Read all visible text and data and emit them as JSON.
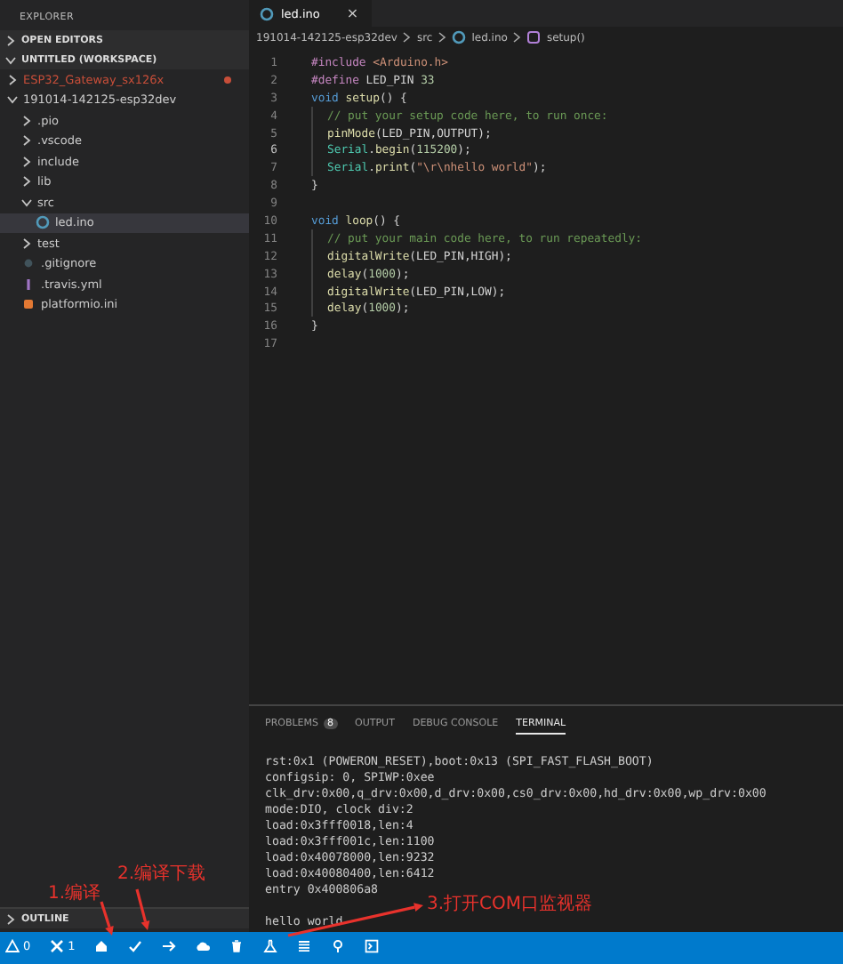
{
  "sidebar": {
    "title": "EXPLORER",
    "sections": [
      {
        "label": "OPEN EDITORS",
        "expanded": false
      },
      {
        "label": "UNTITLED (WORKSPACE)",
        "expanded": true,
        "children": [
          {
            "kind": "folder",
            "label": "ESP32_Gateway_sx126x",
            "expanded": false,
            "modified": true,
            "selected": false
          },
          {
            "kind": "folder",
            "label": "191014-142125-esp32dev",
            "expanded": true,
            "modified": false,
            "selected": false,
            "children": [
              {
                "kind": "folder",
                "label": ".pio",
                "expanded": false,
                "modified": false,
                "selected": false
              },
              {
                "kind": "folder",
                "label": ".vscode",
                "expanded": false,
                "modified": false,
                "selected": false
              },
              {
                "kind": "folder",
                "label": "include",
                "expanded": false,
                "modified": false,
                "selected": false
              },
              {
                "kind": "folder",
                "label": "lib",
                "expanded": false,
                "modified": false,
                "selected": false
              },
              {
                "kind": "folder",
                "label": "src",
                "expanded": true,
                "modified": false,
                "selected": false,
                "children": [
                  {
                    "kind": "c-file",
                    "label": "led.ino",
                    "modified": false,
                    "selected": true
                  }
                ]
              },
              {
                "kind": "folder",
                "label": "test",
                "expanded": false,
                "modified": false,
                "selected": false
              },
              {
                "kind": "git-file",
                "label": ".gitignore",
                "modified": false,
                "selected": false
              },
              {
                "kind": "yaml-file",
                "label": ".travis.yml",
                "modified": false,
                "selected": false
              },
              {
                "kind": "ini-file",
                "label": "platformio.ini",
                "modified": false,
                "selected": false
              }
            ]
          }
        ]
      }
    ],
    "outline": {
      "label": "OUTLINE",
      "expanded": false
    }
  },
  "editor": {
    "tabs": [
      {
        "label": "led.ino",
        "selected": true,
        "close": "×"
      }
    ],
    "breadcrumb": [
      "191014-142125-esp32dev",
      "src",
      "led.ino",
      "setup()"
    ],
    "lines": [
      {
        "number": "1",
        "current": false,
        "indented": false,
        "tokens": [
          {
            "kind": "pre",
            "text": "#include "
          },
          {
            "kind": "str",
            "text": "<Arduino.h>"
          }
        ]
      },
      {
        "number": "2",
        "current": false,
        "indented": false,
        "tokens": [
          {
            "kind": "pre",
            "text": "#define "
          },
          {
            "kind": "plain",
            "text": "LED_PIN "
          },
          {
            "kind": "num",
            "text": "33"
          }
        ]
      },
      {
        "number": "3",
        "current": false,
        "indented": false,
        "tokens": [
          {
            "kind": "key",
            "text": "void "
          },
          {
            "kind": "fn",
            "text": "setup"
          },
          {
            "kind": "plain",
            "text": "() {"
          }
        ]
      },
      {
        "number": "4",
        "current": false,
        "indented": true,
        "tokens": [
          {
            "kind": "comment",
            "text": "// put your setup code here, to run once:"
          }
        ]
      },
      {
        "number": "5",
        "current": false,
        "indented": true,
        "tokens": [
          {
            "kind": "fn",
            "text": "pinMode"
          },
          {
            "kind": "plain",
            "text": "(LED_PIN,OUTPUT);"
          }
        ]
      },
      {
        "number": "6",
        "current": true,
        "indented": true,
        "tokens": [
          {
            "kind": "type",
            "text": "Serial"
          },
          {
            "kind": "plain",
            "text": "."
          },
          {
            "kind": "fn",
            "text": "begin"
          },
          {
            "kind": "plain",
            "text": "("
          },
          {
            "kind": "num",
            "text": "115200"
          },
          {
            "kind": "plain",
            "text": ");"
          }
        ]
      },
      {
        "number": "7",
        "current": false,
        "indented": true,
        "tokens": [
          {
            "kind": "type",
            "text": "Serial"
          },
          {
            "kind": "plain",
            "text": "."
          },
          {
            "kind": "fn",
            "text": "print"
          },
          {
            "kind": "plain",
            "text": "("
          },
          {
            "kind": "str",
            "text": "\"\\r\\nhello world\""
          },
          {
            "kind": "plain",
            "text": ");"
          }
        ]
      },
      {
        "number": "8",
        "current": false,
        "indented": false,
        "tokens": [
          {
            "kind": "plain",
            "text": "}"
          }
        ]
      },
      {
        "number": "9",
        "current": false
      },
      {
        "number": "10",
        "current": false,
        "indented": false,
        "tokens": [
          {
            "kind": "key",
            "text": "void "
          },
          {
            "kind": "fn",
            "text": "loop"
          },
          {
            "kind": "plain",
            "text": "() {"
          }
        ]
      },
      {
        "number": "11",
        "current": false,
        "indented": true,
        "tokens": [
          {
            "kind": "comment",
            "text": "// put your main code here, to run repeatedly:"
          }
        ]
      },
      {
        "number": "12",
        "current": false,
        "indented": true,
        "tokens": [
          {
            "kind": "fn",
            "text": "digitalWrite"
          },
          {
            "kind": "plain",
            "text": "(LED_PIN,HIGH);"
          }
        ]
      },
      {
        "number": "13",
        "current": false,
        "indented": true,
        "tokens": [
          {
            "kind": "fn",
            "text": "delay"
          },
          {
            "kind": "plain",
            "text": "("
          },
          {
            "kind": "num",
            "text": "1000"
          },
          {
            "kind": "plain",
            "text": ");"
          }
        ]
      },
      {
        "number": "14",
        "current": false,
        "indented": true,
        "tokens": [
          {
            "kind": "fn",
            "text": "digitalWrite"
          },
          {
            "kind": "plain",
            "text": "(LED_PIN,LOW);"
          }
        ]
      },
      {
        "number": "15",
        "current": false,
        "indented": true,
        "tokens": [
          {
            "kind": "fn",
            "text": "delay"
          },
          {
            "kind": "plain",
            "text": "("
          },
          {
            "kind": "num",
            "text": "1000"
          },
          {
            "kind": "plain",
            "text": ");"
          }
        ]
      },
      {
        "number": "16",
        "current": false,
        "indented": false,
        "tokens": [
          {
            "kind": "plain",
            "text": "}"
          }
        ]
      },
      {
        "number": "17",
        "current": false
      }
    ]
  },
  "panel": {
    "tabs": [
      {
        "label": "PROBLEMS",
        "badge": "8",
        "selected": false
      },
      {
        "label": "OUTPUT",
        "selected": false
      },
      {
        "label": "DEBUG CONSOLE",
        "selected": false
      },
      {
        "label": "TERMINAL",
        "selected": true
      }
    ],
    "terminal": [
      "rst:0x1 (POWERON_RESET),boot:0x13 (SPI_FAST_FLASH_BOOT)",
      "configsip: 0, SPIWP:0xee",
      "clk_drv:0x00,q_drv:0x00,d_drv:0x00,cs0_drv:0x00,hd_drv:0x00,wp_drv:0x00",
      "mode:DIO, clock div:2",
      "load:0x3fff0018,len:4",
      "load:0x3fff001c,len:1100",
      "load:0x40078000,len:9232",
      "load:0x40080400,len:6412",
      "entry 0x400806a8",
      "hello world"
    ]
  },
  "status_bar": [
    {
      "kind": "warning",
      "text": "0"
    },
    {
      "kind": "tools",
      "text": "1"
    },
    {
      "kind": "home"
    },
    {
      "kind": "check"
    },
    {
      "kind": "arrow"
    },
    {
      "kind": "upload"
    },
    {
      "kind": "trash"
    },
    {
      "kind": "flask"
    },
    {
      "kind": "list"
    },
    {
      "kind": "pin"
    },
    {
      "kind": "terminal"
    }
  ],
  "annotations": [
    "1.编译",
    "2.编译下载",
    "3.打开COM口监视器"
  ]
}
